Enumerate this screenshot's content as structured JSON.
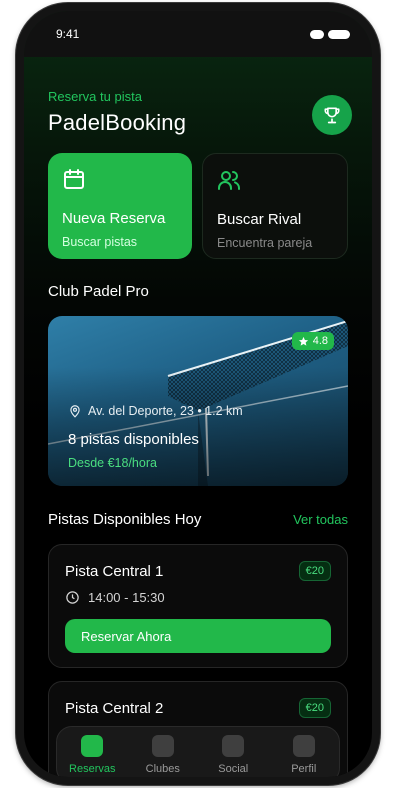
{
  "status_bar": {
    "time": "9:41"
  },
  "header": {
    "subtitle": "Reserva tu pista",
    "title": "PadelBooking",
    "trophy_icon": "trophy-icon"
  },
  "actions": [
    {
      "title": "Nueva Reserva",
      "subtitle": "Buscar pistas",
      "icon": "calendar-icon"
    },
    {
      "title": "Buscar Rival",
      "subtitle": "Encuentra pareja",
      "icon": "users-icon"
    }
  ],
  "club": {
    "section_title": "Club Padel Pro",
    "rating": "4.8",
    "address": "Av. del Deporte, 23 • 1.2 km",
    "courts_available": "8 pistas disponibles",
    "price_from": "Desde €18/hora"
  },
  "available": {
    "title": "Pistas Disponibles Hoy",
    "see_all": "Ver todas",
    "courts": [
      {
        "name": "Pista Central 1",
        "price": "€20",
        "time": "14:00 - 15:30",
        "button": "Reservar Ahora"
      },
      {
        "name": "Pista Central 2",
        "price": "€20"
      }
    ]
  },
  "tabs": [
    {
      "label": "Reservas",
      "active": true
    },
    {
      "label": "Clubes",
      "active": false
    },
    {
      "label": "Social",
      "active": false
    },
    {
      "label": "Perfil",
      "active": false
    }
  ],
  "colors": {
    "accent": "#22b84a",
    "accent_text": "#22c55e",
    "background": "#000000"
  }
}
